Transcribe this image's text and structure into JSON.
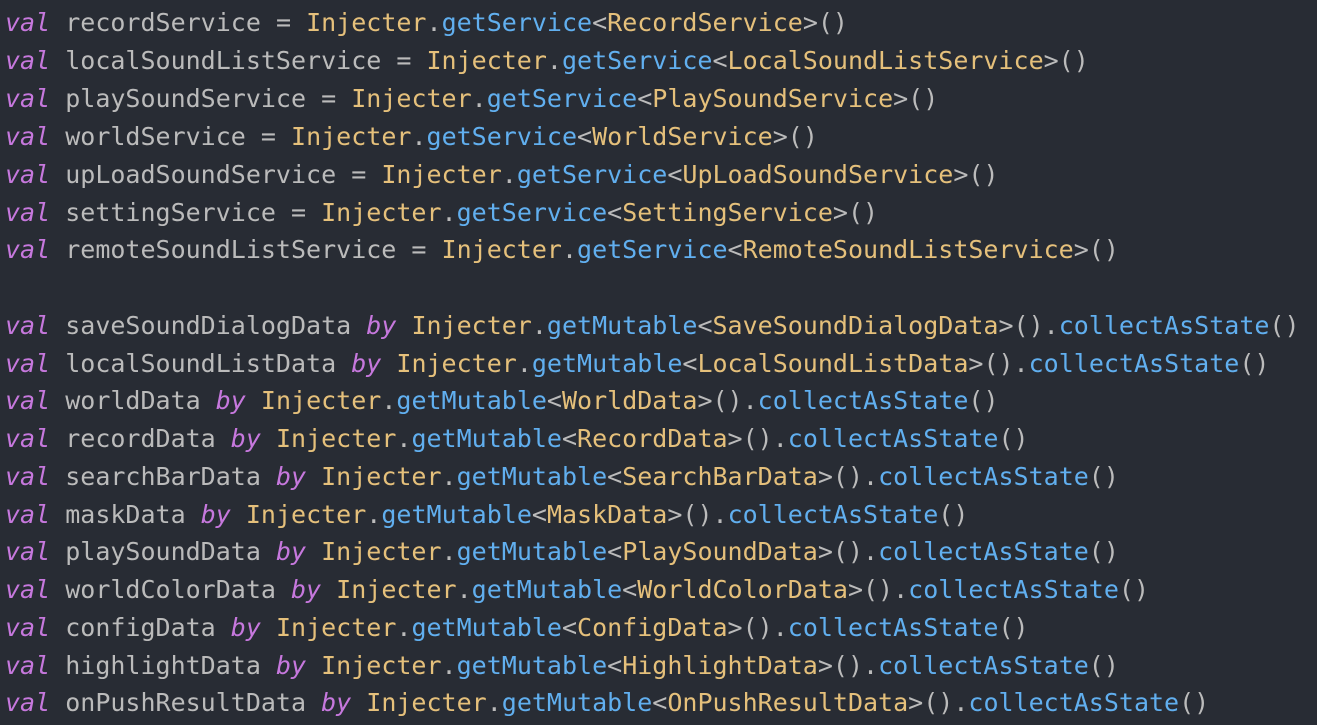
{
  "editor": {
    "background": "#282c34",
    "colors": {
      "keyword": "#c678dd",
      "identifier": "#bbbbbb",
      "class": "#e5c07b",
      "function": "#61afef"
    },
    "services": [
      {
        "kw": "val",
        "name": "recordService",
        "op": "=",
        "obj": "Injecter",
        "fn": "getService",
        "type": "RecordService",
        "tail": ">()"
      },
      {
        "kw": "val",
        "name": "localSoundListService",
        "op": "=",
        "obj": "Injecter",
        "fn": "getService",
        "type": "LocalSoundListService",
        "tail": ">()"
      },
      {
        "kw": "val",
        "name": "playSoundService",
        "op": "=",
        "obj": "Injecter",
        "fn": "getService",
        "type": "PlaySoundService",
        "tail": ">()"
      },
      {
        "kw": "val",
        "name": "worldService",
        "op": "=",
        "obj": "Injecter",
        "fn": "getService",
        "type": "WorldService",
        "tail": ">()"
      },
      {
        "kw": "val",
        "name": "upLoadSoundService",
        "op": "=",
        "obj": "Injecter",
        "fn": "getService",
        "type": "UpLoadSoundService",
        "tail": ">()"
      },
      {
        "kw": "val",
        "name": "settingService",
        "op": "=",
        "obj": "Injecter",
        "fn": "getService",
        "type": "SettingService",
        "tail": ">()"
      },
      {
        "kw": "val",
        "name": "remoteSoundListService",
        "op": "=",
        "obj": "Injecter",
        "fn": "getService",
        "type": "RemoteSoundListService",
        "tail": ">()"
      }
    ],
    "states": [
      {
        "kw": "val",
        "name": "saveSoundDialogData",
        "op": "by",
        "obj": "Injecter",
        "fn": "getMutable",
        "type": "SaveSoundDialogData",
        "mid": ">().",
        "call": "collectAsState",
        "tail": "()"
      },
      {
        "kw": "val",
        "name": "localSoundListData",
        "op": "by",
        "obj": "Injecter",
        "fn": "getMutable",
        "type": "LocalSoundListData",
        "mid": ">().",
        "call": "collectAsState",
        "tail": "()"
      },
      {
        "kw": "val",
        "name": "worldData",
        "op": "by",
        "obj": "Injecter",
        "fn": "getMutable",
        "type": "WorldData",
        "mid": ">().",
        "call": "collectAsState",
        "tail": "()"
      },
      {
        "kw": "val",
        "name": "recordData",
        "op": "by",
        "obj": "Injecter",
        "fn": "getMutable",
        "type": "RecordData",
        "mid": ">().",
        "call": "collectAsState",
        "tail": "()"
      },
      {
        "kw": "val",
        "name": "searchBarData",
        "op": "by",
        "obj": "Injecter",
        "fn": "getMutable",
        "type": "SearchBarData",
        "mid": ">().",
        "call": "collectAsState",
        "tail": "()"
      },
      {
        "kw": "val",
        "name": "maskData",
        "op": "by",
        "obj": "Injecter",
        "fn": "getMutable",
        "type": "MaskData",
        "mid": ">().",
        "call": "collectAsState",
        "tail": "()"
      },
      {
        "kw": "val",
        "name": "playSoundData",
        "op": "by",
        "obj": "Injecter",
        "fn": "getMutable",
        "type": "PlaySoundData",
        "mid": ">().",
        "call": "collectAsState",
        "tail": "()"
      },
      {
        "kw": "val",
        "name": "worldColorData",
        "op": "by",
        "obj": "Injecter",
        "fn": "getMutable",
        "type": "WorldColorData",
        "mid": ">().",
        "call": "collectAsState",
        "tail": "()"
      },
      {
        "kw": "val",
        "name": "configData",
        "op": "by",
        "obj": "Injecter",
        "fn": "getMutable",
        "type": "ConfigData",
        "mid": ">().",
        "call": "collectAsState",
        "tail": "()"
      },
      {
        "kw": "val",
        "name": "highlightData",
        "op": "by",
        "obj": "Injecter",
        "fn": "getMutable",
        "type": "HighlightData",
        "mid": ">().",
        "call": "collectAsState",
        "tail": "()"
      },
      {
        "kw": "val",
        "name": "onPushResultData",
        "op": "by",
        "obj": "Injecter",
        "fn": "getMutable",
        "type": "OnPushResultData",
        "mid": ">().",
        "call": "collectAsState",
        "tail": "()"
      }
    ]
  }
}
